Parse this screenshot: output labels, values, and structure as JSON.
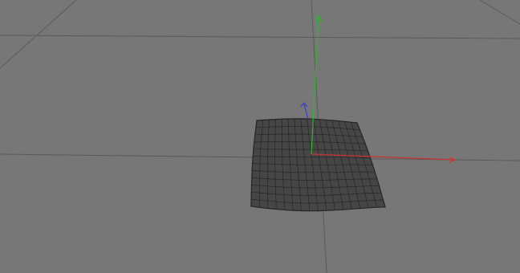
{
  "viewport": {
    "background_color": "#777777",
    "grid_color": "#5a5a5a",
    "grid_secondary_color": "#6c6c6c"
  },
  "mesh": {
    "fill_color": "#464646",
    "wire_color": "#262626",
    "grid_resolution": [
      16,
      12
    ]
  },
  "gizmo": {
    "x_axis_color": "#c83232",
    "y_axis_color": "#2fb32f",
    "z_axis_color": "#3b3bd0"
  }
}
